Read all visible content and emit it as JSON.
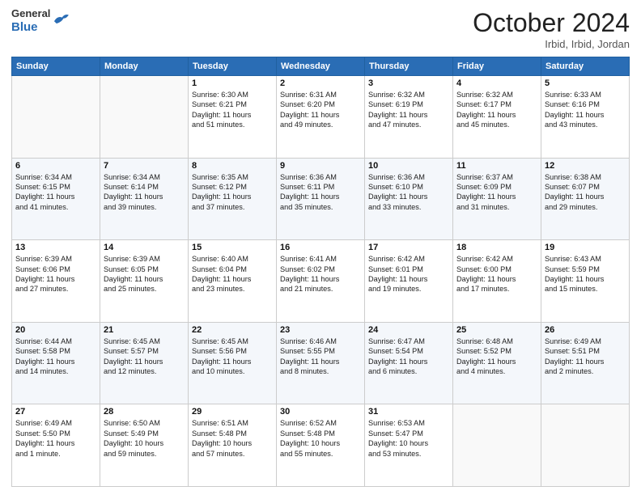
{
  "logo": {
    "general": "General",
    "blue": "Blue"
  },
  "header": {
    "month_year": "October 2024",
    "location": "Irbid, Irbid, Jordan"
  },
  "weekdays": [
    "Sunday",
    "Monday",
    "Tuesday",
    "Wednesday",
    "Thursday",
    "Friday",
    "Saturday"
  ],
  "weeks": [
    [
      {
        "day": "",
        "info": ""
      },
      {
        "day": "",
        "info": ""
      },
      {
        "day": "1",
        "info": "Sunrise: 6:30 AM\nSunset: 6:21 PM\nDaylight: 11 hours\nand 51 minutes."
      },
      {
        "day": "2",
        "info": "Sunrise: 6:31 AM\nSunset: 6:20 PM\nDaylight: 11 hours\nand 49 minutes."
      },
      {
        "day": "3",
        "info": "Sunrise: 6:32 AM\nSunset: 6:19 PM\nDaylight: 11 hours\nand 47 minutes."
      },
      {
        "day": "4",
        "info": "Sunrise: 6:32 AM\nSunset: 6:17 PM\nDaylight: 11 hours\nand 45 minutes."
      },
      {
        "day": "5",
        "info": "Sunrise: 6:33 AM\nSunset: 6:16 PM\nDaylight: 11 hours\nand 43 minutes."
      }
    ],
    [
      {
        "day": "6",
        "info": "Sunrise: 6:34 AM\nSunset: 6:15 PM\nDaylight: 11 hours\nand 41 minutes."
      },
      {
        "day": "7",
        "info": "Sunrise: 6:34 AM\nSunset: 6:14 PM\nDaylight: 11 hours\nand 39 minutes."
      },
      {
        "day": "8",
        "info": "Sunrise: 6:35 AM\nSunset: 6:12 PM\nDaylight: 11 hours\nand 37 minutes."
      },
      {
        "day": "9",
        "info": "Sunrise: 6:36 AM\nSunset: 6:11 PM\nDaylight: 11 hours\nand 35 minutes."
      },
      {
        "day": "10",
        "info": "Sunrise: 6:36 AM\nSunset: 6:10 PM\nDaylight: 11 hours\nand 33 minutes."
      },
      {
        "day": "11",
        "info": "Sunrise: 6:37 AM\nSunset: 6:09 PM\nDaylight: 11 hours\nand 31 minutes."
      },
      {
        "day": "12",
        "info": "Sunrise: 6:38 AM\nSunset: 6:07 PM\nDaylight: 11 hours\nand 29 minutes."
      }
    ],
    [
      {
        "day": "13",
        "info": "Sunrise: 6:39 AM\nSunset: 6:06 PM\nDaylight: 11 hours\nand 27 minutes."
      },
      {
        "day": "14",
        "info": "Sunrise: 6:39 AM\nSunset: 6:05 PM\nDaylight: 11 hours\nand 25 minutes."
      },
      {
        "day": "15",
        "info": "Sunrise: 6:40 AM\nSunset: 6:04 PM\nDaylight: 11 hours\nand 23 minutes."
      },
      {
        "day": "16",
        "info": "Sunrise: 6:41 AM\nSunset: 6:02 PM\nDaylight: 11 hours\nand 21 minutes."
      },
      {
        "day": "17",
        "info": "Sunrise: 6:42 AM\nSunset: 6:01 PM\nDaylight: 11 hours\nand 19 minutes."
      },
      {
        "day": "18",
        "info": "Sunrise: 6:42 AM\nSunset: 6:00 PM\nDaylight: 11 hours\nand 17 minutes."
      },
      {
        "day": "19",
        "info": "Sunrise: 6:43 AM\nSunset: 5:59 PM\nDaylight: 11 hours\nand 15 minutes."
      }
    ],
    [
      {
        "day": "20",
        "info": "Sunrise: 6:44 AM\nSunset: 5:58 PM\nDaylight: 11 hours\nand 14 minutes."
      },
      {
        "day": "21",
        "info": "Sunrise: 6:45 AM\nSunset: 5:57 PM\nDaylight: 11 hours\nand 12 minutes."
      },
      {
        "day": "22",
        "info": "Sunrise: 6:45 AM\nSunset: 5:56 PM\nDaylight: 11 hours\nand 10 minutes."
      },
      {
        "day": "23",
        "info": "Sunrise: 6:46 AM\nSunset: 5:55 PM\nDaylight: 11 hours\nand 8 minutes."
      },
      {
        "day": "24",
        "info": "Sunrise: 6:47 AM\nSunset: 5:54 PM\nDaylight: 11 hours\nand 6 minutes."
      },
      {
        "day": "25",
        "info": "Sunrise: 6:48 AM\nSunset: 5:52 PM\nDaylight: 11 hours\nand 4 minutes."
      },
      {
        "day": "26",
        "info": "Sunrise: 6:49 AM\nSunset: 5:51 PM\nDaylight: 11 hours\nand 2 minutes."
      }
    ],
    [
      {
        "day": "27",
        "info": "Sunrise: 6:49 AM\nSunset: 5:50 PM\nDaylight: 11 hours\nand 1 minute."
      },
      {
        "day": "28",
        "info": "Sunrise: 6:50 AM\nSunset: 5:49 PM\nDaylight: 10 hours\nand 59 minutes."
      },
      {
        "day": "29",
        "info": "Sunrise: 6:51 AM\nSunset: 5:48 PM\nDaylight: 10 hours\nand 57 minutes."
      },
      {
        "day": "30",
        "info": "Sunrise: 6:52 AM\nSunset: 5:48 PM\nDaylight: 10 hours\nand 55 minutes."
      },
      {
        "day": "31",
        "info": "Sunrise: 6:53 AM\nSunset: 5:47 PM\nDaylight: 10 hours\nand 53 minutes."
      },
      {
        "day": "",
        "info": ""
      },
      {
        "day": "",
        "info": ""
      }
    ]
  ]
}
